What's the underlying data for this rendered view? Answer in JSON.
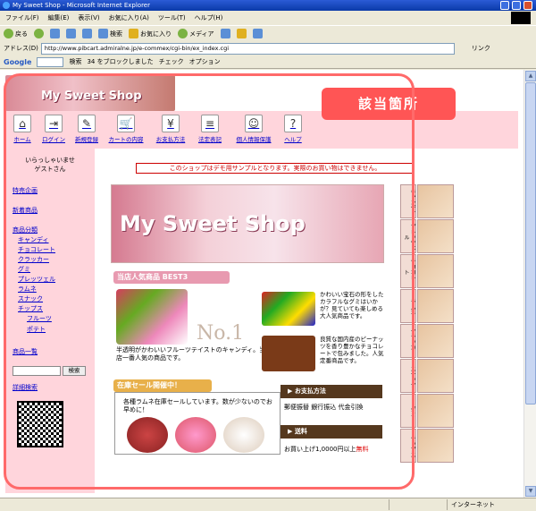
{
  "window": {
    "title": "My Sweet Shop - Microsoft Internet Explorer"
  },
  "menu": [
    "ファイル(F)",
    "編集(E)",
    "表示(V)",
    "お気に入り(A)",
    "ツール(T)",
    "ヘルプ(H)"
  ],
  "toolbar": {
    "back": "戻る",
    "search": "検索",
    "favorites": "お気に入り",
    "media": "メディア"
  },
  "address": {
    "label": "アドレス(D)",
    "url": "http://www.pibcart.admiralne.jp/e-commex/cgi-bin/ex_index.cgi",
    "go": "リンク"
  },
  "google_bar": {
    "logo": "Google",
    "search_label": "検索",
    "blocked": "34 をブロックしました",
    "check": "チェック",
    "options": "オプション"
  },
  "page": {
    "logo": "My Sweet Shop",
    "callout": "該当箇所",
    "nav": [
      {
        "label": "ホーム",
        "icon": "home-icon"
      },
      {
        "label": "ログイン",
        "icon": "login-icon"
      },
      {
        "label": "新規登録",
        "icon": "register-icon"
      },
      {
        "label": "カートの内容",
        "icon": "cart-icon"
      },
      {
        "label": "お支払方法",
        "icon": "payment-icon"
      },
      {
        "label": "法定表記",
        "icon": "legal-icon"
      },
      {
        "label": "個人情報保護",
        "icon": "privacy-icon"
      },
      {
        "label": "ヘルプ",
        "icon": "help-icon"
      }
    ],
    "sidebar": {
      "greeting_line1": "いらっしゃいませ",
      "greeting_line2": "ゲストさん",
      "special": "特売企画",
      "new_items": "新着商品",
      "categories_title": "商品分類",
      "categories": [
        "キャンディ",
        "チョコレート",
        "クラッカー",
        "グミ",
        "プレッツェル",
        "ラムネ",
        "スナック",
        "チップス"
      ],
      "sub_categories": [
        "フルーツ",
        "ポテト"
      ],
      "list_all": "商品一覧",
      "search_button": "検索",
      "advanced_search": "詳細検索"
    },
    "notice": "このショップはデモ用サンプルとなります。実際のお買い物はできません。",
    "banner_title": "My Sweet Shop",
    "side_tabs": [
      "キャンディ",
      "プレッツェル",
      "チョコレート",
      "ラムネ",
      "クラッカー",
      "スナック",
      "グミ",
      "チップス"
    ],
    "best": {
      "heading": "当店人気商品 BEST3",
      "no1_label": "No.1",
      "item1_text": "半透明がかわいいフルーツテイストのキャンディ。当店一番人気の商品です。",
      "item2_text": "かわいい宝石の形をしたカラフルなグミはいかが？見ていても楽しめる大人気商品です。",
      "item3_text": "良質な国内産のピーナッツを香り豊かなチョコレートで包みました。人気定番商品です。"
    },
    "sale": {
      "heading": "在庫セール開催中！",
      "text": "各種ラムネ在庫セールしています。数が少ないのでお早めに！"
    },
    "payment": {
      "heading": "▶ お支払方法",
      "text": "郵便振替 銀行振込 代金引換"
    },
    "shipping": {
      "heading": "▶ 送料",
      "text_prefix": "お買い上げ1,0000円以上",
      "free": "無料"
    }
  },
  "status": {
    "zone": "インターネット"
  }
}
